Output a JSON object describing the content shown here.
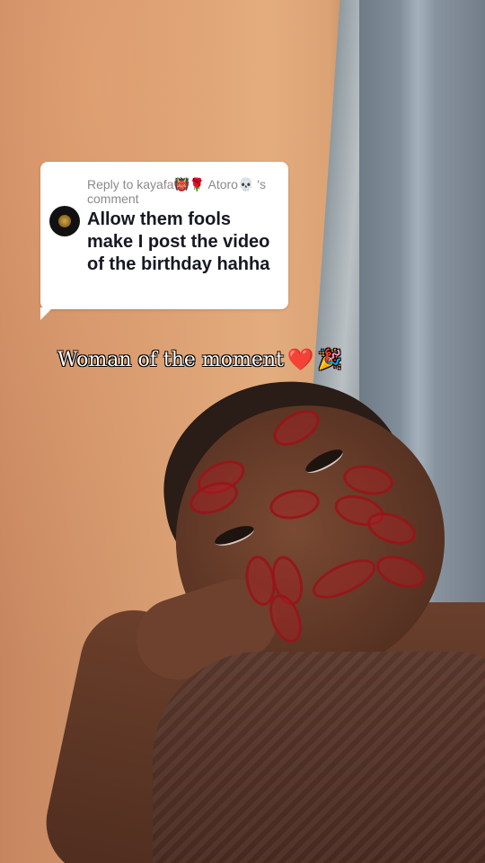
{
  "reply": {
    "header_prefix": "Reply to kayafa",
    "header_emoji": "👹🌹",
    "header_name": "Atoro",
    "header_skull": "💀",
    "header_suffix": "'s",
    "header_line2": "comment",
    "comment_text": "Allow them fools make I post the video of the birthday hahha",
    "avatar_icon": "lion-logo-icon"
  },
  "caption": {
    "text": "Woman of the moment",
    "heart": "❤️",
    "party": "🎉"
  },
  "colors": {
    "wall": "#d49a6f",
    "door": "#7e8a95",
    "bubble": "#ffffff",
    "header_text": "#8a8a8a",
    "comment_text": "#161823",
    "lipstick": "#9a1419"
  }
}
